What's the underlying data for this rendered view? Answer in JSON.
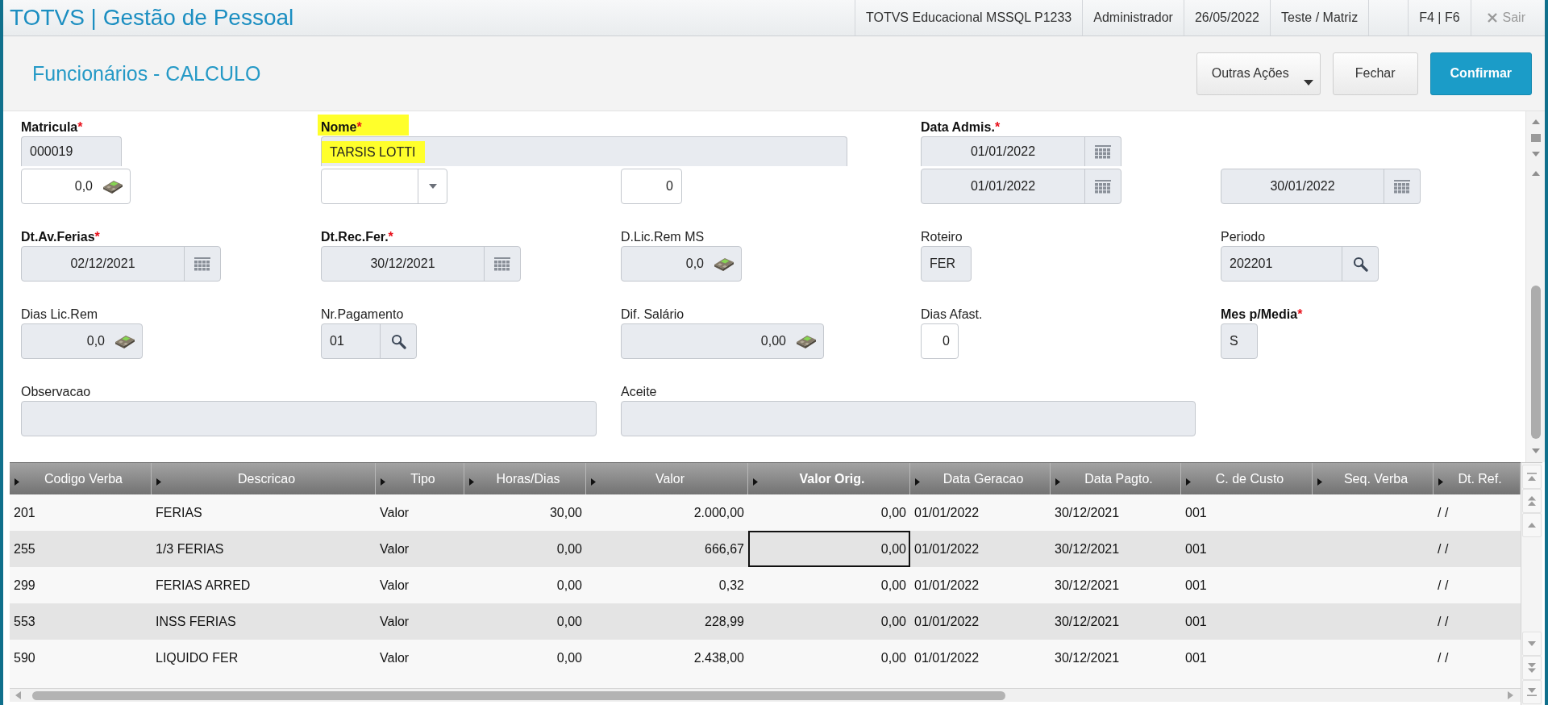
{
  "top_bar": {
    "title": "TOTVS | Gestão de Pessoal",
    "info": [
      "TOTVS Educacional MSSQL P1233",
      "Administrador",
      "26/05/2022",
      "Teste / Matriz",
      "F4 | F6"
    ],
    "exit": {
      "label": "Sair",
      "disabled": true
    }
  },
  "page_header": {
    "title": "Funcionários - CALCULO",
    "buttons": [
      {
        "label": "Outras Ações",
        "kind": "menu"
      },
      {
        "label": "Fechar",
        "kind": "default"
      },
      {
        "label": "Confirmar",
        "kind": "primary"
      }
    ]
  },
  "form": {
    "rows": [
      [
        {
          "label": "Matricula",
          "required": true,
          "required_mark": "*",
          "kind": "text",
          "value": "000019",
          "readonly": true,
          "highlighted": false
        },
        {
          "label": "Nome",
          "required": true,
          "required_mark": "*",
          "kind": "text",
          "value": "TARSIS LOTTI",
          "readonly": true,
          "highlighted": true
        },
        null,
        {
          "label": "Data Admis.",
          "required": true,
          "required_mark": "*",
          "kind": "date",
          "value": "01/01/2022",
          "readonly": true,
          "highlighted": false
        }
      ],
      [
        {
          "kind": "calculator",
          "value": "0,0",
          "readonly": false,
          "highlighted": false
        },
        {
          "kind": "select",
          "readonly": false,
          "highlighted": false
        },
        {
          "kind": "number",
          "value": "0",
          "readonly": false,
          "highlighted": false
        },
        {
          "kind": "date",
          "value": "01/01/2022",
          "readonly": true,
          "highlighted": false
        },
        {
          "kind": "date",
          "value": "30/01/2022",
          "readonly": true,
          "highlighted": false
        }
      ],
      [
        {
          "label": "Dt.Av.Ferias",
          "required": true,
          "required_mark": "*",
          "kind": "date",
          "value": "02/12/2021",
          "readonly": true,
          "highlighted": false
        },
        {
          "label": "Dt.Rec.Fer.",
          "required": true,
          "required_mark": "*",
          "kind": "date",
          "value": "30/12/2021",
          "readonly": true,
          "highlighted": false
        },
        {
          "label": "D.Lic.Rem MS",
          "required": false,
          "kind": "calculator",
          "value": "0,0",
          "readonly": true,
          "highlighted": false
        },
        {
          "label": "Roteiro",
          "required": false,
          "kind": "text",
          "value": "FER",
          "readonly": true,
          "highlighted": false
        },
        {
          "label": "Periodo",
          "required": false,
          "kind": "lookup",
          "value": "202201",
          "readonly": true,
          "highlighted": false
        }
      ],
      [
        {
          "label": "Dias Lic.Rem",
          "required": false,
          "kind": "calculator",
          "value": "0,0",
          "readonly": true,
          "highlighted": false
        },
        {
          "label": "Nr.Pagamento",
          "required": false,
          "kind": "lookup",
          "value": "01",
          "readonly": true,
          "highlighted": false
        },
        {
          "label": "Dif. Salário",
          "required": false,
          "kind": "calculator",
          "value": "0,00",
          "readonly": true,
          "highlighted": false
        },
        {
          "label": "Dias Afast.",
          "required": false,
          "kind": "number",
          "value": "0",
          "readonly": false,
          "highlighted": false
        },
        {
          "label": "Mes p/Media",
          "required": true,
          "required_mark": "*",
          "kind": "text",
          "value": "S",
          "readonly": true,
          "highlighted": false
        }
      ],
      [
        {
          "label": "Observacao",
          "required": false,
          "kind": "text",
          "readonly": true,
          "highlighted": false
        },
        null,
        {
          "label": "Aceite",
          "required": false,
          "kind": "text",
          "readonly": true,
          "highlighted": false
        }
      ]
    ]
  },
  "table": {
    "columns": [
      {
        "label": "Codigo Verba",
        "kind": "text",
        "selected": false
      },
      {
        "label": "Descricao",
        "kind": "text",
        "selected": false
      },
      {
        "label": "Tipo",
        "kind": "text",
        "selected": false
      },
      {
        "label": "Horas/Dias",
        "kind": "number",
        "selected": false
      },
      {
        "label": "Valor",
        "kind": "number",
        "selected": false
      },
      {
        "label": "Valor Orig.",
        "kind": "number",
        "selected": true
      },
      {
        "label": "Data Geracao",
        "kind": "text",
        "selected": false
      },
      {
        "label": "Data Pagto.",
        "kind": "text",
        "selected": false
      },
      {
        "label": "C. de Custo",
        "kind": "text",
        "selected": false
      },
      {
        "label": "Seq. Verba",
        "kind": "text",
        "selected": false
      },
      {
        "label": "Dt. Ref.",
        "kind": "text",
        "selected": false
      }
    ],
    "rows": [
      {
        "cells": [
          "201",
          "FERIAS",
          "Valor",
          "30,00",
          "2.000,00",
          "0,00",
          "01/01/2022",
          "30/12/2021",
          "001",
          null,
          "/ /"
        ],
        "selected": false
      },
      {
        "cells": [
          "255",
          "1/3 FERIAS",
          "Valor",
          "0,00",
          "666,67",
          "0,00",
          "01/01/2022",
          "30/12/2021",
          "001",
          null,
          "/ /"
        ],
        "selected": true
      },
      {
        "cells": [
          "299",
          "FERIAS ARRED",
          "Valor",
          "0,00",
          "0,32",
          "0,00",
          "01/01/2022",
          "30/12/2021",
          "001",
          null,
          "/ /"
        ],
        "selected": false
      },
      {
        "cells": [
          "553",
          "INSS FERIAS",
          "Valor",
          "0,00",
          "228,99",
          "0,00",
          "01/01/2022",
          "30/12/2021",
          "001",
          null,
          "/ /"
        ],
        "selected": false
      },
      {
        "cells": [
          "590",
          "LIQUIDO FER",
          "Valor",
          "0,00",
          "2.438,00",
          "0,00",
          "01/01/2022",
          "30/12/2021",
          "001",
          null,
          "/ /"
        ],
        "selected": false
      }
    ]
  }
}
